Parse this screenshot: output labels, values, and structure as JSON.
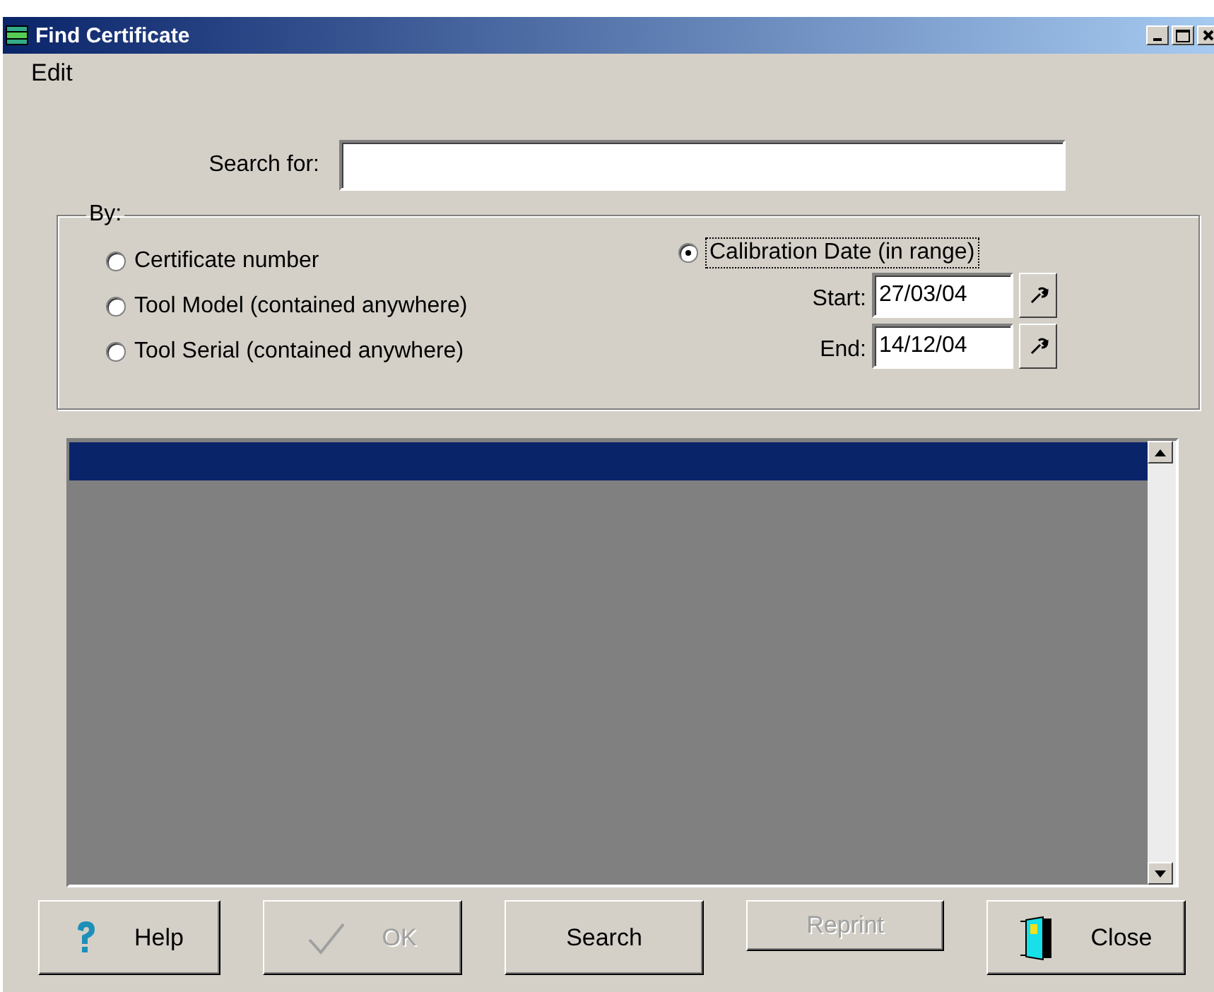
{
  "window": {
    "title": "Find Certificate"
  },
  "menu": [
    {
      "label": "Edit"
    }
  ],
  "search": {
    "label": "Search for:"
  },
  "by_group": {
    "label": "By:",
    "options": [
      {
        "label": "Certificate number",
        "selected": false
      },
      {
        "label": "Tool Model (contained anywhere)",
        "selected": false
      },
      {
        "label": "Tool Serial (contained anywhere)",
        "selected": false
      },
      {
        "label": "Calibration Date (in range)",
        "selected": true
      }
    ],
    "dates": [
      {
        "label": "Start:",
        "value": "27/03/04"
      },
      {
        "label": "End:",
        "value": "14/12/04"
      }
    ]
  },
  "results": {
    "rows": [
      {
        "selected": true
      }
    ]
  },
  "buttons": [
    {
      "kind": "help",
      "label": "Help",
      "disabled": false
    },
    {
      "kind": "ok",
      "label": "OK",
      "disabled": true
    },
    {
      "kind": "search",
      "label": "Search",
      "disabled": false
    },
    {
      "kind": "reprint",
      "label": "Reprint",
      "disabled": true
    },
    {
      "kind": "close",
      "label": "Close",
      "disabled": false
    }
  ]
}
